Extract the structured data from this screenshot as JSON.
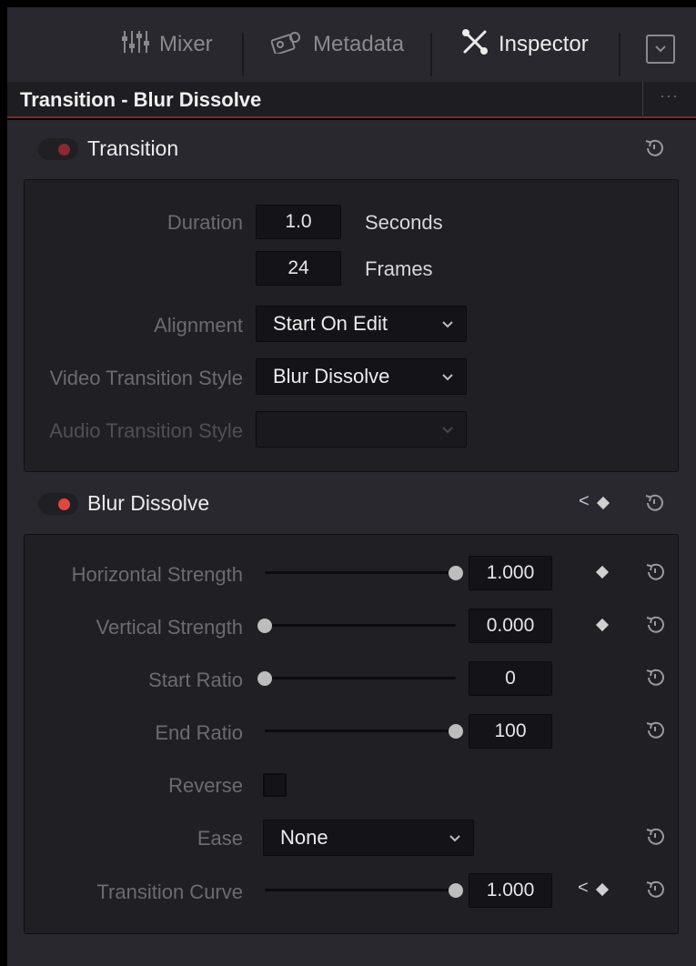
{
  "toolbar": {
    "mixer_label": "Mixer",
    "metadata_label": "Metadata",
    "inspector_label": "Inspector"
  },
  "header": {
    "title": "Transition - Blur Dissolve",
    "more": "..."
  },
  "transition_section": {
    "title": "Transition",
    "toggle_color": "#8a2a2e",
    "duration_label": "Duration",
    "duration_seconds": "1.0",
    "seconds_unit": "Seconds",
    "duration_frames": "24",
    "frames_unit": "Frames",
    "alignment_label": "Alignment",
    "alignment_value": "Start On Edit",
    "video_style_label": "Video Transition Style",
    "video_style_value": "Blur Dissolve",
    "audio_style_label": "Audio Transition Style",
    "audio_style_value": ""
  },
  "blur_section": {
    "title": "Blur Dissolve",
    "toggle_color": "#e0473f",
    "params": {
      "horizontal_strength": {
        "label": "Horizontal Strength",
        "value": "1.000",
        "level": 1.0
      },
      "vertical_strength": {
        "label": "Vertical Strength",
        "value": "0.000",
        "level": 0.0
      },
      "start_ratio": {
        "label": "Start Ratio",
        "value": "0",
        "level": 0.0
      },
      "end_ratio": {
        "label": "End Ratio",
        "value": "100",
        "level": 1.0
      },
      "reverse": {
        "label": "Reverse",
        "checked": false
      },
      "ease": {
        "label": "Ease",
        "value": "None"
      },
      "transition_curve": {
        "label": "Transition Curve",
        "value": "1.000",
        "level": 1.0
      }
    }
  },
  "icons": {
    "mixer": "mixer-icon",
    "metadata": "metadata-icon",
    "inspector": "inspector-icon",
    "reset": "reset-icon",
    "keyframe": "keyframe-diamond-icon",
    "chevron": "chevron-down-icon"
  }
}
